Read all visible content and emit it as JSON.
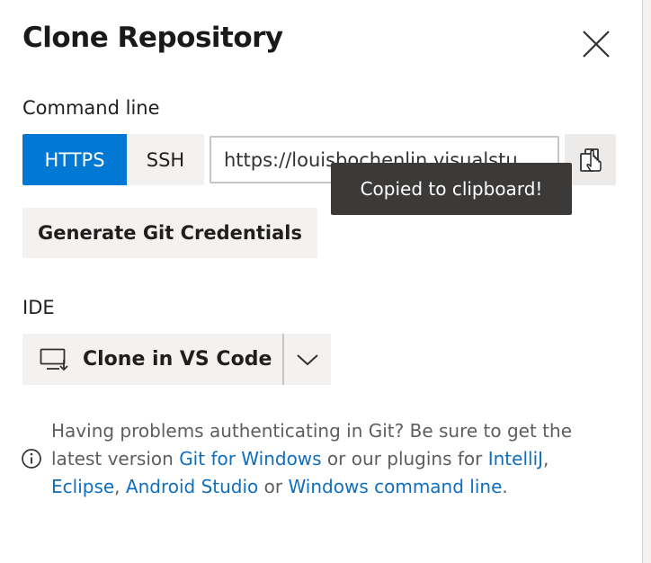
{
  "dialog": {
    "title": "Clone Repository"
  },
  "command_line": {
    "label": "Command line",
    "https_label": "HTTPS",
    "ssh_label": "SSH",
    "selected": "HTTPS",
    "url_visible": "https://louisbochenlin.visualstu",
    "tooltip": "Copied to clipboard!",
    "generate_label": "Generate Git Credentials"
  },
  "ide": {
    "label": "IDE",
    "clone_label": "Clone in VS Code"
  },
  "info": {
    "text_1": "Having problems authenticating in Git? Be sure to get the latest version ",
    "link_git_windows": "Git for Windows",
    "text_2": " or our plugins for ",
    "link_intellij": "IntelliJ",
    "text_3": ", ",
    "link_eclipse": "Eclipse",
    "text_4": ", ",
    "link_android_studio": "Android Studio",
    "text_5": " or ",
    "link_windows_cmd": "Windows command line",
    "text_6": "."
  },
  "colors": {
    "accent": "#0078d4",
    "link": "#106ebe",
    "tooltip_bg": "#3b3a39",
    "button_bg": "#f3f2f1"
  },
  "icons": [
    "close-icon",
    "copy-icon",
    "cursor-hand-icon",
    "vs-code-clone-icon",
    "chevron-down-icon",
    "info-icon"
  ]
}
